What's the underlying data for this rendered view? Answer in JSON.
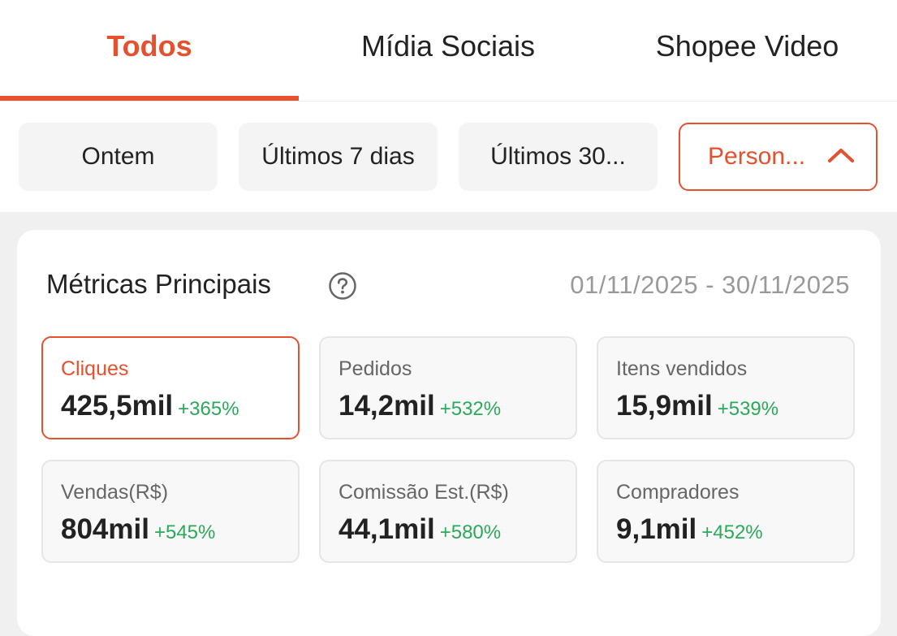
{
  "tabs": [
    {
      "label": "Todos",
      "active": true
    },
    {
      "label": "Mídia Sociais",
      "active": false
    },
    {
      "label": "Shopee Video",
      "active": false
    }
  ],
  "filters": [
    {
      "label": "Ontem",
      "active": false
    },
    {
      "label": "Últimos 7 dias",
      "active": false
    },
    {
      "label": "Últimos 30...",
      "active": false
    },
    {
      "label": "Person...",
      "active": true,
      "icon": "chevron-up-icon"
    }
  ],
  "metrics_card": {
    "title": "Métricas Principais",
    "help_icon": "question-circle-icon",
    "date_range": "01/11/2025 - 30/11/2025",
    "items": [
      {
        "label": "Cliques",
        "value": "425,5mil",
        "change": "+365%",
        "selected": true
      },
      {
        "label": "Pedidos",
        "value": "14,2mil",
        "change": "+532%",
        "selected": false
      },
      {
        "label": "Itens vendidos",
        "value": "15,9mil",
        "change": "+539%",
        "selected": false
      },
      {
        "label": "Vendas(R$)",
        "value": "804mil",
        "change": "+545%",
        "selected": false
      },
      {
        "label": "Comissão Est.(R$)",
        "value": "44,1mil",
        "change": "+580%",
        "selected": false
      },
      {
        "label": "Compradores",
        "value": "9,1mil",
        "change": "+452%",
        "selected": false
      }
    ]
  },
  "colors": {
    "accent": "#e4512f",
    "positive": "#2aa95a",
    "background": "#f0f0f0"
  }
}
